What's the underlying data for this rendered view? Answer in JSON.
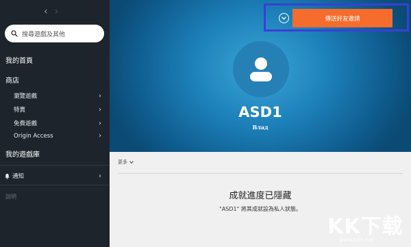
{
  "nav": {
    "back": "‹",
    "forward": "›"
  },
  "search": {
    "placeholder": "搜尋遊戲及其他"
  },
  "sidebar": {
    "home": "我的首頁",
    "store": "商店",
    "store_items": [
      {
        "label": "瀏覽遊戲"
      },
      {
        "label": "特賣"
      },
      {
        "label": "免費遊戲"
      },
      {
        "label": "Origin Access"
      }
    ],
    "library": "我的遊戲庫",
    "notifications": "通知",
    "help": "說明"
  },
  "profile": {
    "invite_label": "傳送好友邀請",
    "username": "ASD1",
    "realname": "Влад"
  },
  "content": {
    "more_label": "更多",
    "achievements_title": "成就進度已隱藏",
    "achievements_desc": "\"ASD1\" 將其成就設為私人狀態。"
  },
  "watermark": {
    "logo": "KK下载",
    "url": "www.kkx.net"
  },
  "colors": {
    "sidebar_bg": "#1e242c",
    "hero_blue": "#1c7fb8",
    "invite_orange": "#f56c2d",
    "highlight": "#3a3fd6"
  },
  "icons": [
    "search-icon",
    "chevron-right-icon",
    "bell-icon",
    "chevron-down-icon",
    "user-avatar-icon"
  ]
}
